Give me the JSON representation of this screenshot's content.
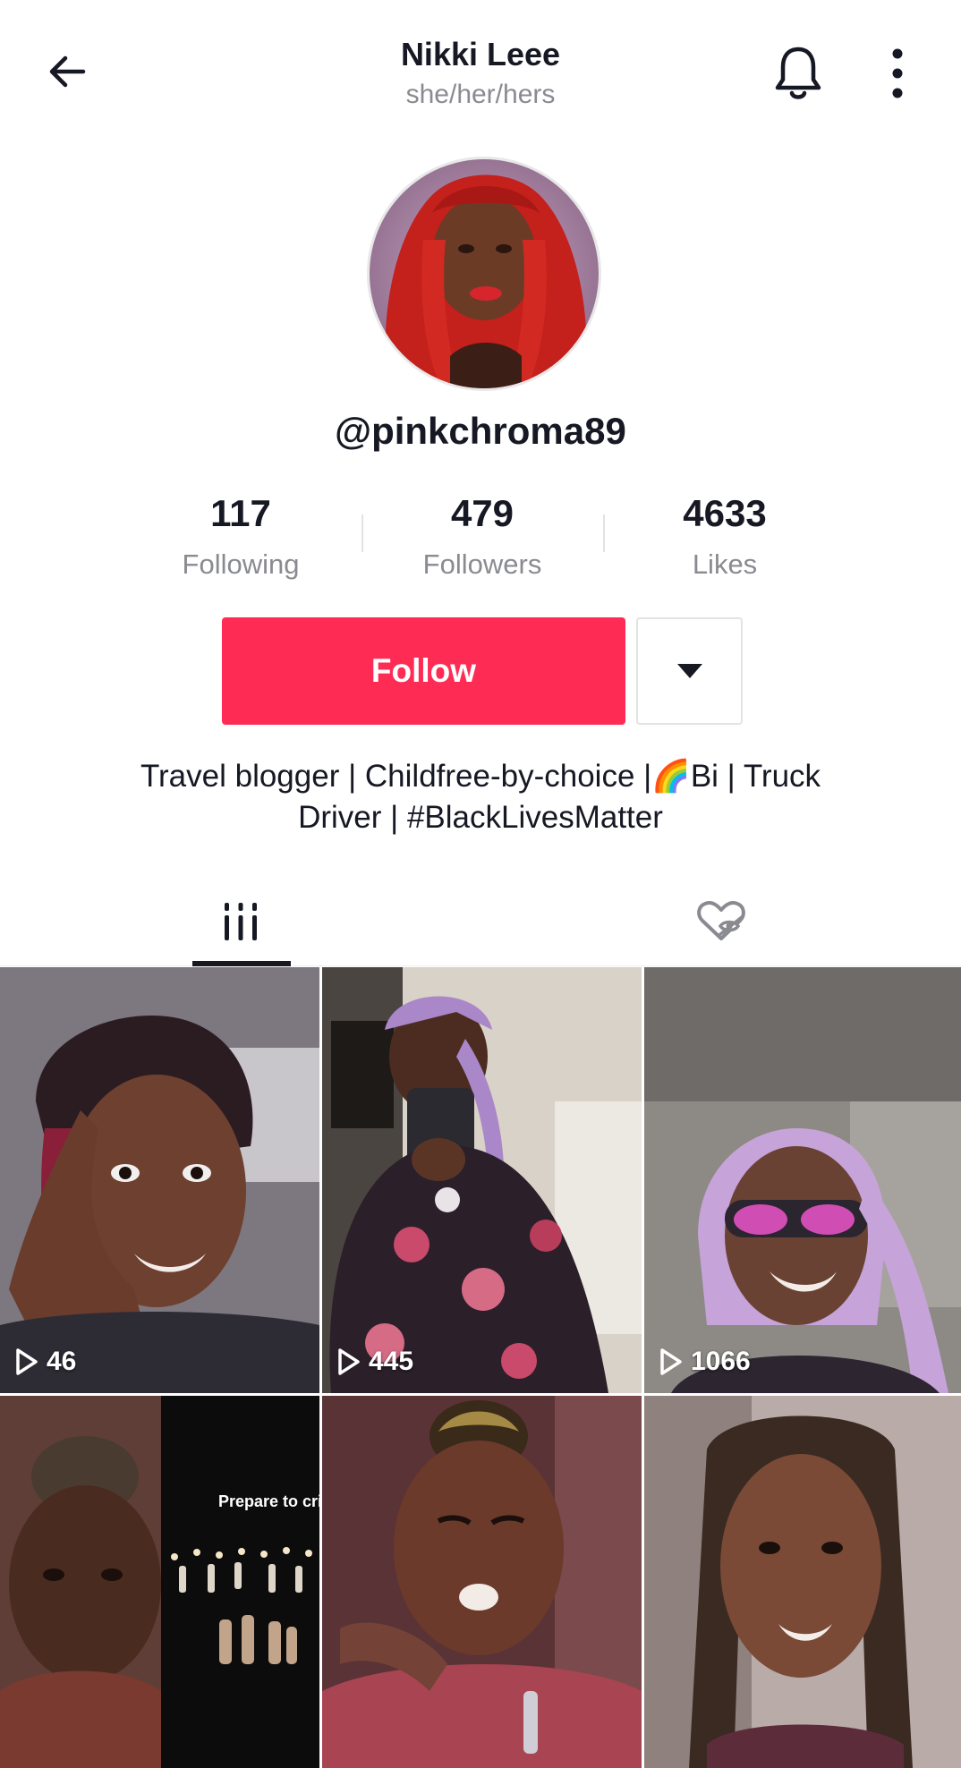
{
  "header": {
    "title": "Nikki Leee",
    "subtitle": "she/her/hers"
  },
  "profile": {
    "username": "@pinkchroma89",
    "stats": [
      {
        "value": "117",
        "label": "Following"
      },
      {
        "value": "479",
        "label": "Followers"
      },
      {
        "value": "4633",
        "label": "Likes"
      }
    ],
    "follow_label": "Follow",
    "bio_line1": "Travel blogger | Childfree-by-choice |🌈Bi | Truck",
    "bio_line2": "Driver | #BlackLivesMatter"
  },
  "tabs": [
    {
      "name": "videos",
      "icon": "grid-lines-icon",
      "active": true
    },
    {
      "name": "liked",
      "icon": "hidden-heart-icon",
      "active": false
    }
  ],
  "videos": [
    {
      "views": "46"
    },
    {
      "views": "445"
    },
    {
      "views": "1066"
    },
    {
      "views": "",
      "caption": "Prepare to cri"
    },
    {
      "views": ""
    },
    {
      "views": ""
    }
  ],
  "colors": {
    "accent": "#fe2c55",
    "text_primary": "#161823",
    "text_secondary": "#8a8b91"
  }
}
